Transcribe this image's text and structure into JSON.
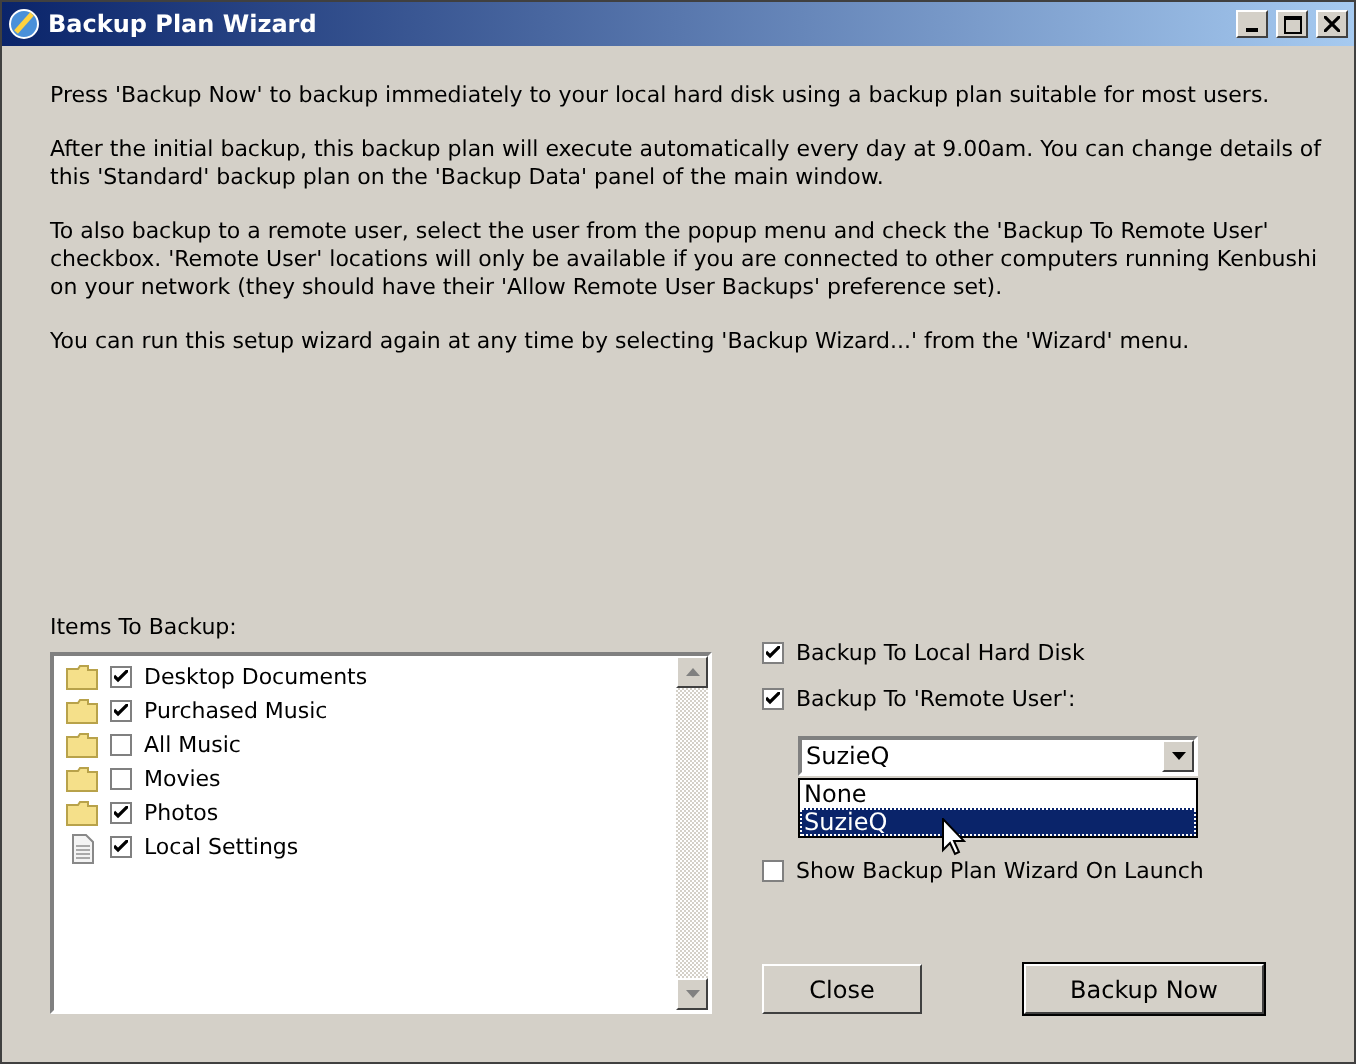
{
  "window": {
    "title": "Backup Plan Wizard",
    "controls": [
      {
        "kind": "minimize"
      },
      {
        "kind": "maximize"
      },
      {
        "kind": "close"
      }
    ]
  },
  "paragraphs": [
    "Press 'Backup Now' to backup immediately to your local hard disk using a backup plan suitable for most users.",
    "After the initial backup, this backup plan will execute automatically every day at 9.00am. You can change details of this 'Standard' backup plan on the 'Backup Data' panel of the main window.",
    "To also backup to a remote user, select the user from the popup menu and check the 'Backup To Remote User' checkbox. 'Remote User' locations will only be available if you are connected to other computers running Kenbushi on your network (they should have their 'Allow Remote User Backups' preference set).",
    "You can run this setup wizard again at any time by selecting 'Backup Wizard...' from the 'Wizard' menu."
  ],
  "items_label": "Items To Backup:",
  "items": [
    {
      "kind": "folder",
      "label": "Desktop Documents",
      "checked": true
    },
    {
      "kind": "folder",
      "label": "Purchased Music",
      "checked": true
    },
    {
      "kind": "folder",
      "label": "All Music",
      "checked": false
    },
    {
      "kind": "folder",
      "label": "Movies",
      "checked": false
    },
    {
      "kind": "folder",
      "label": "Photos",
      "checked": true
    },
    {
      "kind": "file",
      "label": "Local Settings",
      "checked": true
    }
  ],
  "options": [
    {
      "label": "Backup To Local Hard Disk",
      "checked": true
    },
    {
      "label": "Backup To 'Remote User':",
      "checked": true
    }
  ],
  "remote_user": {
    "value": "SuzieQ",
    "expanded": true,
    "options": [
      {
        "label": "None",
        "selected": false
      },
      {
        "label": "SuzieQ",
        "selected": true
      }
    ]
  },
  "show_on_launch": {
    "label": "Show Backup Plan Wizard On Launch",
    "checked": false
  },
  "buttons": [
    {
      "label": "Close",
      "default": false
    },
    {
      "label": "Backup Now",
      "default": true
    }
  ]
}
